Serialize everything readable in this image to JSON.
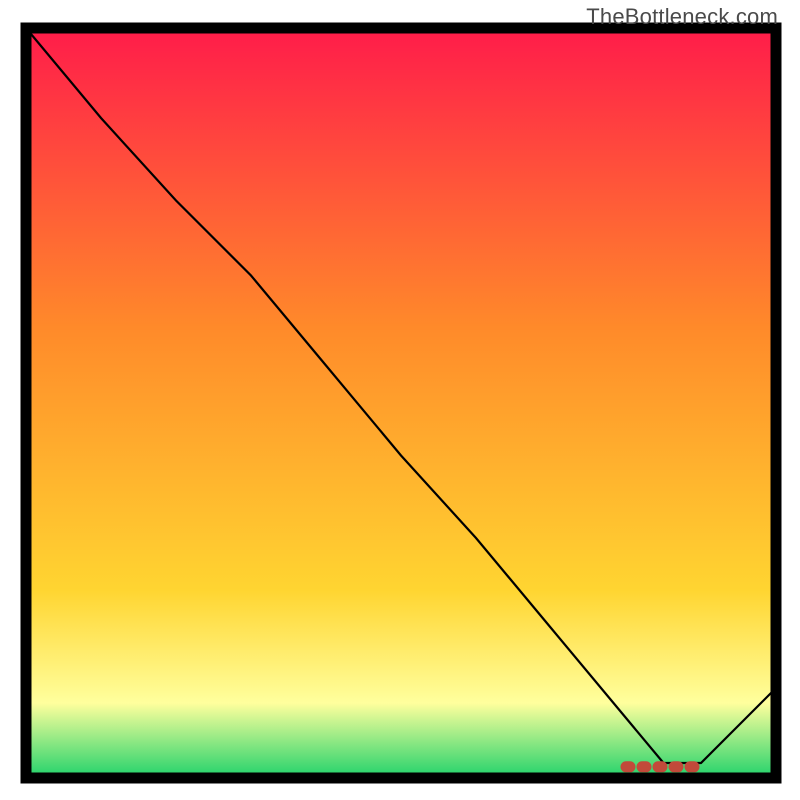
{
  "watermark": "TheBottleneck.com",
  "chart_data": {
    "type": "line",
    "x": [
      0.0,
      0.1,
      0.2,
      0.3,
      0.4,
      0.5,
      0.6,
      0.7,
      0.8,
      0.85,
      0.9,
      1.0
    ],
    "y": [
      1.0,
      0.88,
      0.77,
      0.67,
      0.55,
      0.43,
      0.32,
      0.2,
      0.08,
      0.02,
      0.02,
      0.12
    ],
    "title": "",
    "xlabel": "",
    "ylabel": "",
    "xlim": [
      0,
      1
    ],
    "ylim": [
      0,
      1
    ],
    "optimal_band": {
      "x_start": 0.8,
      "x_end": 0.9
    },
    "background_gradient": {
      "top": "#ff1c4a",
      "mid1": "#ff8a2a",
      "mid2": "#ffd531",
      "band": "#ffff9d",
      "bottom": "#21d26b"
    },
    "line_color": "#000000",
    "marker_color": "#c24a3a",
    "frame_color": "#000000"
  }
}
